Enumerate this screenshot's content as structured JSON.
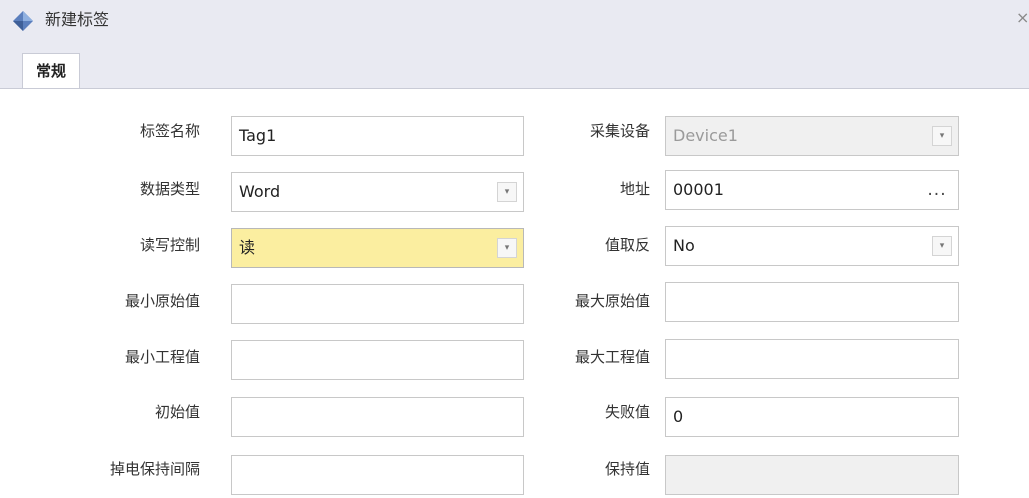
{
  "window": {
    "title": "新建标签",
    "close_glyph": "×",
    "icon": "tag-diamond-icon"
  },
  "tabs": [
    {
      "label": "常规",
      "active": true
    }
  ],
  "form": {
    "tag_name": {
      "label": "标签名称",
      "value": "Tag1"
    },
    "data_type": {
      "label": "数据类型",
      "value": "Word",
      "dropdown_glyph": "▾"
    },
    "rw_control": {
      "label": "读写控制",
      "value": "读",
      "dropdown_glyph": "▾"
    },
    "min_raw": {
      "label": "最小原始值",
      "value": ""
    },
    "min_eng": {
      "label": "最小工程值",
      "value": ""
    },
    "initial_value": {
      "label": "初始值",
      "value": ""
    },
    "power_hold_interval": {
      "label": "掉电保持间隔",
      "value": ""
    },
    "device": {
      "label": "采集设备",
      "value": "Device1",
      "dropdown_glyph": "▾",
      "disabled": true
    },
    "address": {
      "label": "地址",
      "value": "00001",
      "browse_glyph": "..."
    },
    "invert": {
      "label": "值取反",
      "value": "No",
      "dropdown_glyph": "▾"
    },
    "max_raw": {
      "label": "最大原始值",
      "value": ""
    },
    "max_eng": {
      "label": "最大工程值",
      "value": ""
    },
    "fail_value": {
      "label": "失败值",
      "value": "0"
    },
    "hold_value": {
      "label": "保持值",
      "value": "",
      "disabled": true
    }
  },
  "colors": {
    "chrome": "#e9eaf2",
    "highlight_field": "#fbeea0",
    "disabled_field": "#f0f0f0",
    "icon_blue": "#5b7fbd"
  }
}
